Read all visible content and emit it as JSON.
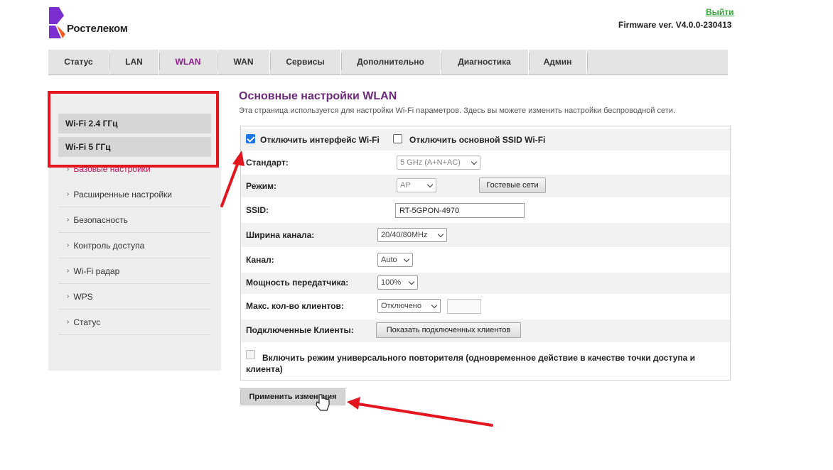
{
  "brand": {
    "name": "Ростелеком",
    "logout": "Выйти",
    "firmware": "Firmware ver. V4.0.0-230413",
    "colors": {
      "accent": "#8c1a8c",
      "logo_purple": "#7b2fd0",
      "logo_orange": "#ff5a1f",
      "annotation_red": "#e3161e"
    }
  },
  "topnav": {
    "tabs": [
      "Статус",
      "LAN",
      "WLAN",
      "WAN",
      "Сервисы",
      "Дополнительно",
      "Диагностика",
      "Админ"
    ],
    "active": "WLAN"
  },
  "sidebar": {
    "bands": [
      "Wi-Fi 2.4 ГГц",
      "Wi-Fi 5 ГГц"
    ],
    "items": [
      "Базовые настройки",
      "Расширенные настройки",
      "Безопасность",
      "Контроль доступа",
      "Wi-Fi радар",
      "WPS",
      "Статус"
    ],
    "active_item": "Базовые настройки"
  },
  "main": {
    "title": "Основные настройки WLAN",
    "description": "Эта страница используется для настройки Wi-Fi параметров. Здесь вы можете изменить настройки беспроводной сети.",
    "disable_wifi": {
      "label": "Отключить интерфейс Wi-Fi",
      "checked": true
    },
    "disable_ssid": {
      "label": "Отключить основной SSID Wi-Fi",
      "checked": false
    },
    "standard": {
      "label": "Стандарт:",
      "value": "5 GHz (A+N+AC)"
    },
    "mode": {
      "label": "Режим:",
      "value": "AP",
      "guest_button": "Гостевые сети"
    },
    "ssid": {
      "label": "SSID:",
      "value": "RT-5GPON-4970"
    },
    "channel_width": {
      "label": "Ширина канала:",
      "value": "20/40/80MHz"
    },
    "channel": {
      "label": "Канал:",
      "value": "Auto"
    },
    "tx_power": {
      "label": "Мощность передатчика:",
      "value": "100%"
    },
    "max_clients": {
      "label": "Макс. кол-во клиентов:",
      "value": "Отключено",
      "number": ""
    },
    "connected": {
      "label": "Подключенные Клиенты:",
      "button": "Показать подключенных клиентов"
    },
    "repeater": {
      "label": "Включить режим универсального повторителя (одновременное действие в качестве точки доступа и клиента)",
      "checked": false
    },
    "apply": "Применить изменения"
  }
}
